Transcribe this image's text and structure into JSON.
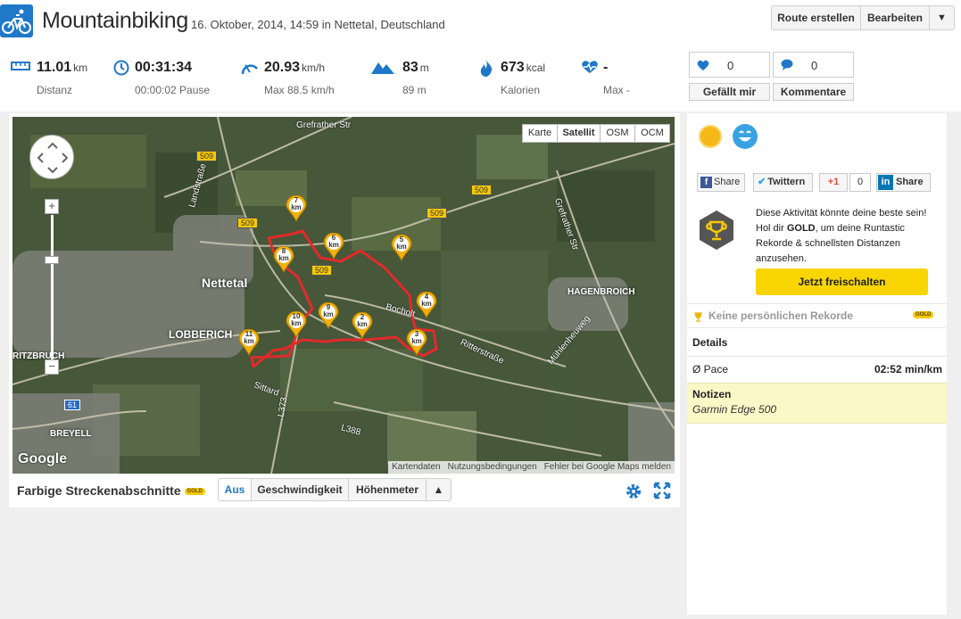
{
  "header": {
    "title": "Mountainbiking",
    "subtitle": "16. Oktober, 2014, 14:59 in Nettetal, Deutschland",
    "route_button": "Route erstellen",
    "edit_button": "Bearbeiten"
  },
  "stats": [
    {
      "icon": "ruler-icon",
      "value": "11.01",
      "unit": "km",
      "sub": "Distanz"
    },
    {
      "icon": "clock-icon",
      "value": "00:31:34",
      "unit": "",
      "sub": "00:00:02 Pause"
    },
    {
      "icon": "speedometer-icon",
      "value": "20.93",
      "unit": "km/h",
      "sub": "Max 88.5 km/h"
    },
    {
      "icon": "mountain-icon",
      "value": "83",
      "unit": "m",
      "sub": "89 m"
    },
    {
      "icon": "flame-icon",
      "value": "673",
      "unit": "kcal",
      "sub": "Kalorien"
    },
    {
      "icon": "heartrate-icon",
      "value": "-",
      "unit": "",
      "sub": "Max -"
    }
  ],
  "social": {
    "likes_count": "0",
    "comments_count": "0",
    "like_button": "Gefällt mir",
    "comment_button": "Kommentare"
  },
  "map": {
    "types": [
      "Karte",
      "Satellit",
      "OSM",
      "OCM"
    ],
    "active_type": "Satellit",
    "footer": [
      "Kartendaten",
      "Nutzungsbedingungen",
      "Fehler bei Google Maps melden"
    ],
    "logo": "Google",
    "places": [
      "Nettetal",
      "LOBBERICH",
      "HAGENBROICH",
      "RITZBRUCH",
      "BREYELL"
    ],
    "streets": [
      "Grefrather Str",
      "Landstraße",
      "Bocholt",
      "Ritterstraße",
      "Mühlenheuweg",
      "Grefrather Str",
      "Sittard",
      "L373",
      "L388"
    ],
    "road_numbers": [
      "509",
      "509",
      "509",
      "509",
      "509",
      "61"
    ],
    "km_markers": [
      "7",
      "6",
      "8",
      "5",
      "4",
      "9",
      "2",
      "10",
      "11",
      "3"
    ],
    "km_unit": "km"
  },
  "segments": {
    "label": "Farbige Streckenabschnitte",
    "gold_tag": "GOLD",
    "buttons": [
      "Aus",
      "Geschwindigkeit",
      "Höhenmeter"
    ],
    "active": "Aus"
  },
  "share": {
    "facebook": "Share",
    "twitter": "Twittern",
    "gplus": "+1",
    "gplus_count": "0",
    "linkedin": "Share",
    "linkedin_logo": "in"
  },
  "gold_promo": {
    "text_prefix": "Diese Aktivität könnte deine beste sein! Hol dir ",
    "text_bold": "GOLD",
    "text_suffix": ", um deine Runtastic Rekorde & schnellsten Distanzen anzusehen.",
    "button": "Jetzt freischalten"
  },
  "records": {
    "label": "Keine persönlichen Rekorde",
    "gold_tag": "GOLD"
  },
  "details": {
    "heading": "Details",
    "pace_label": "Ø Pace",
    "pace_value": "02:52 min/km"
  },
  "notes": {
    "heading": "Notizen",
    "text": "Garmin Edge 500"
  },
  "colors": {
    "brand_blue": "#1f78c8",
    "gold": "#f7c900",
    "route_red": "#e32a2a"
  }
}
